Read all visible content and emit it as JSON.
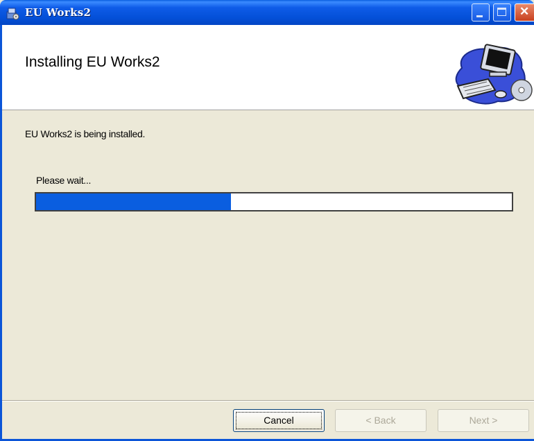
{
  "window": {
    "title": "EU Works2",
    "icon": "installer-icon",
    "controls": {
      "minimize_icon": "minimize-icon",
      "maximize_icon": "maximize-icon",
      "close_icon": "close-icon"
    }
  },
  "header": {
    "title": "Installing EU Works2",
    "banner_icon": "computer-with-cd-icon"
  },
  "body": {
    "status_text": "EU Works2 is being installed.",
    "wait_label": "Please wait...",
    "progress_fraction": 0.41
  },
  "footer": {
    "cancel_label": "Cancel",
    "back_label": "< Back",
    "next_label": "Next >"
  },
  "colors": {
    "titlebar_blue": "#0450d8",
    "progress_fill": "#0a5ee0",
    "dialog_bg": "#ece9d8"
  }
}
